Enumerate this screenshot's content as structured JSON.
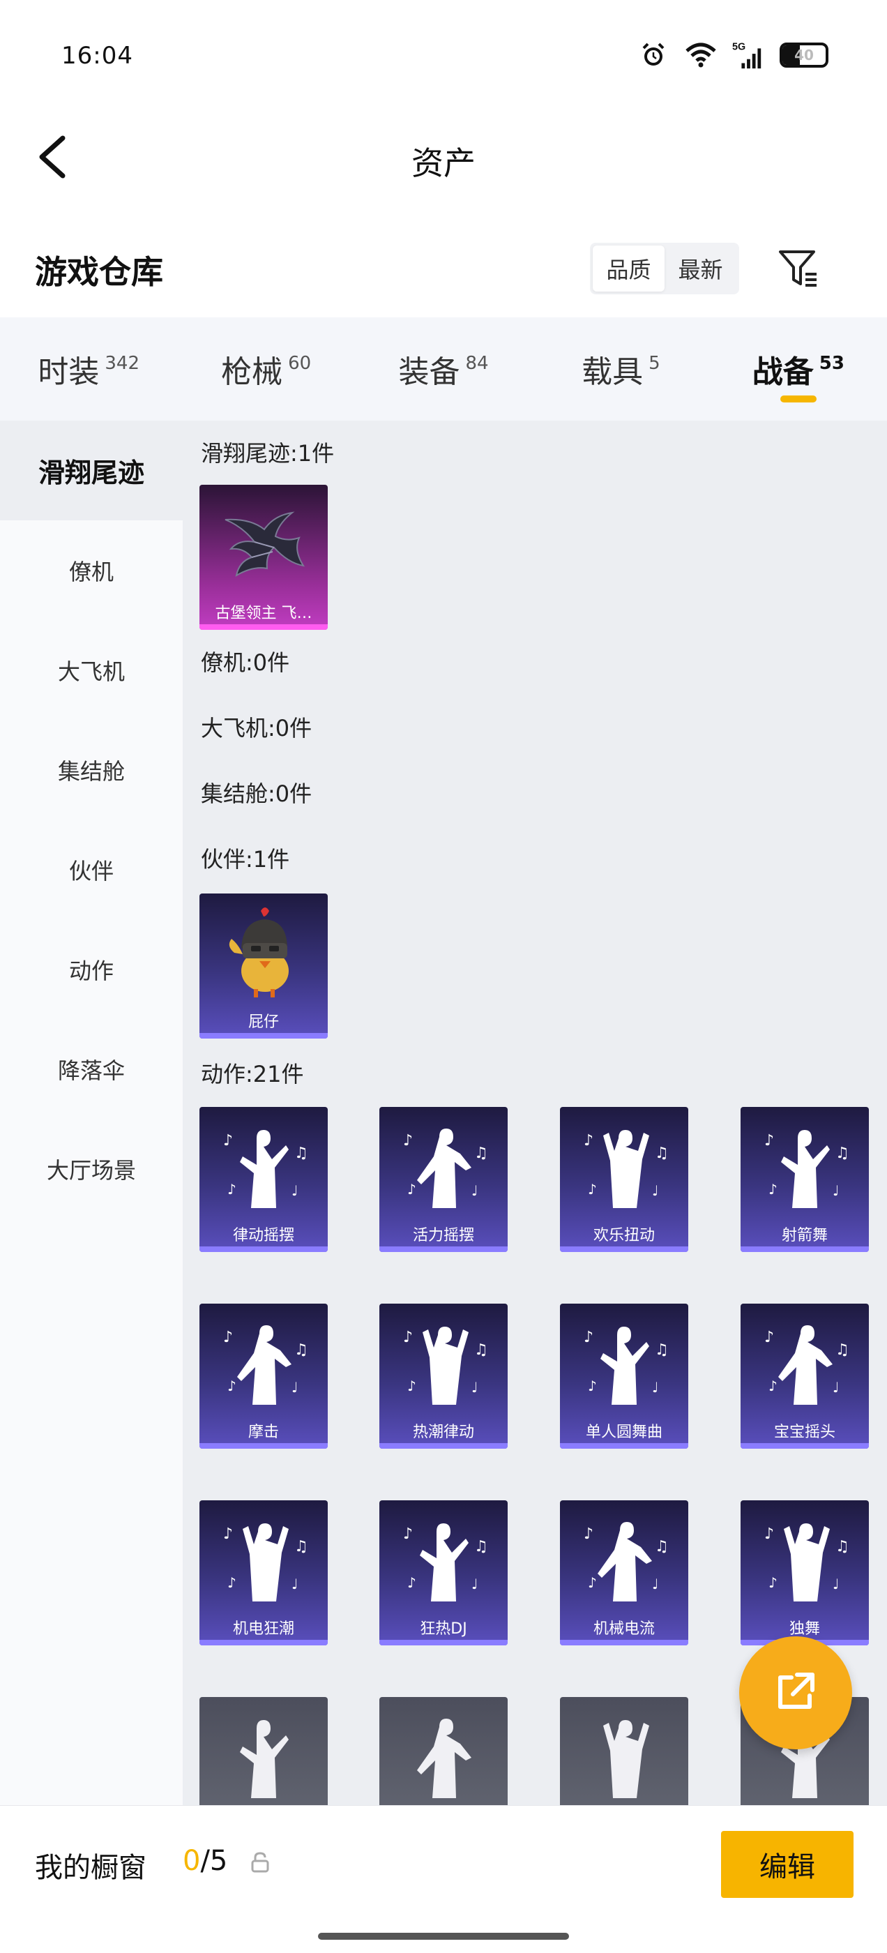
{
  "status_bar": {
    "time": "16:04",
    "network": "5G",
    "battery": "40"
  },
  "header": {
    "title": "资产"
  },
  "section": {
    "title": "游戏仓库",
    "sort_options": [
      "品质",
      "最新"
    ],
    "sort_selected": "品质"
  },
  "tabs": [
    {
      "label": "时装",
      "count": "342"
    },
    {
      "label": "枪械",
      "count": "60"
    },
    {
      "label": "装备",
      "count": "84"
    },
    {
      "label": "载具",
      "count": "5"
    },
    {
      "label": "战备",
      "count": "53"
    }
  ],
  "active_tab": "战备",
  "sidebar": {
    "items": [
      {
        "label": "滑翔尾迹"
      },
      {
        "label": "僚机"
      },
      {
        "label": "大飞机"
      },
      {
        "label": "集结舱"
      },
      {
        "label": "伙伴"
      },
      {
        "label": "动作"
      },
      {
        "label": "降落伞"
      },
      {
        "label": "大厅场景"
      }
    ],
    "active": "滑翔尾迹"
  },
  "groups": {
    "trail": {
      "label": "滑翔尾迹:1件",
      "items": [
        {
          "name": "古堡领主 飞…",
          "icon": "bat-wing-icon"
        }
      ]
    },
    "wingman": {
      "label": "僚机:0件"
    },
    "plane": {
      "label": "大飞机:0件"
    },
    "pod": {
      "label": "集结舱:0件"
    },
    "partner": {
      "label": "伙伴:1件",
      "items": [
        {
          "name": "屁仔",
          "icon": "chick-helmet-icon"
        }
      ]
    },
    "emotes": {
      "label": "动作:21件",
      "items": [
        {
          "name": "律动摇摆"
        },
        {
          "name": "活力摇摆"
        },
        {
          "name": "欢乐扭动"
        },
        {
          "name": "射箭舞"
        },
        {
          "name": "摩击"
        },
        {
          "name": "热潮律动"
        },
        {
          "name": "单人圆舞曲"
        },
        {
          "name": "宝宝摇头"
        },
        {
          "name": "机电狂潮"
        },
        {
          "name": "狂热DJ"
        },
        {
          "name": "机械电流"
        },
        {
          "name": "独舞"
        },
        {
          "name": ""
        },
        {
          "name": ""
        },
        {
          "name": ""
        },
        {
          "name": ""
        }
      ]
    }
  },
  "bottom": {
    "showcase_label": "我的橱窗",
    "showcase_current": "0",
    "showcase_total": "/5",
    "edit_label": "编辑"
  },
  "colors": {
    "accent": "#f7b400",
    "fab": "#f7ac1a",
    "card_purple": "#3a3580",
    "card_pink": "#9a2f9a"
  }
}
